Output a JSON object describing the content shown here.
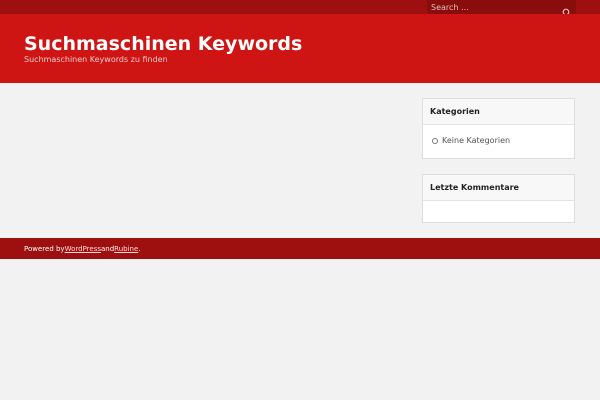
{
  "topbar": {
    "search": {
      "placeholder": "Search ...",
      "icon": "search-icon"
    }
  },
  "header": {
    "title": "Suchmaschinen Keywords",
    "tagline": "Suchmaschinen Keywords zu finden"
  },
  "sidebar": {
    "categories": {
      "title": "Kategorien",
      "items": [
        "Keine Kategorien"
      ]
    },
    "recent_comments": {
      "title": "Letzte Kommentare"
    }
  },
  "footer": {
    "powered_by": "Powered by ",
    "wordpress": "WordPress",
    "and": " and ",
    "theme": "Rubine",
    "period": "."
  },
  "colors": {
    "header_red": "#cf1414",
    "dark_red": "#9e1010",
    "background": "#f2f2f2"
  }
}
